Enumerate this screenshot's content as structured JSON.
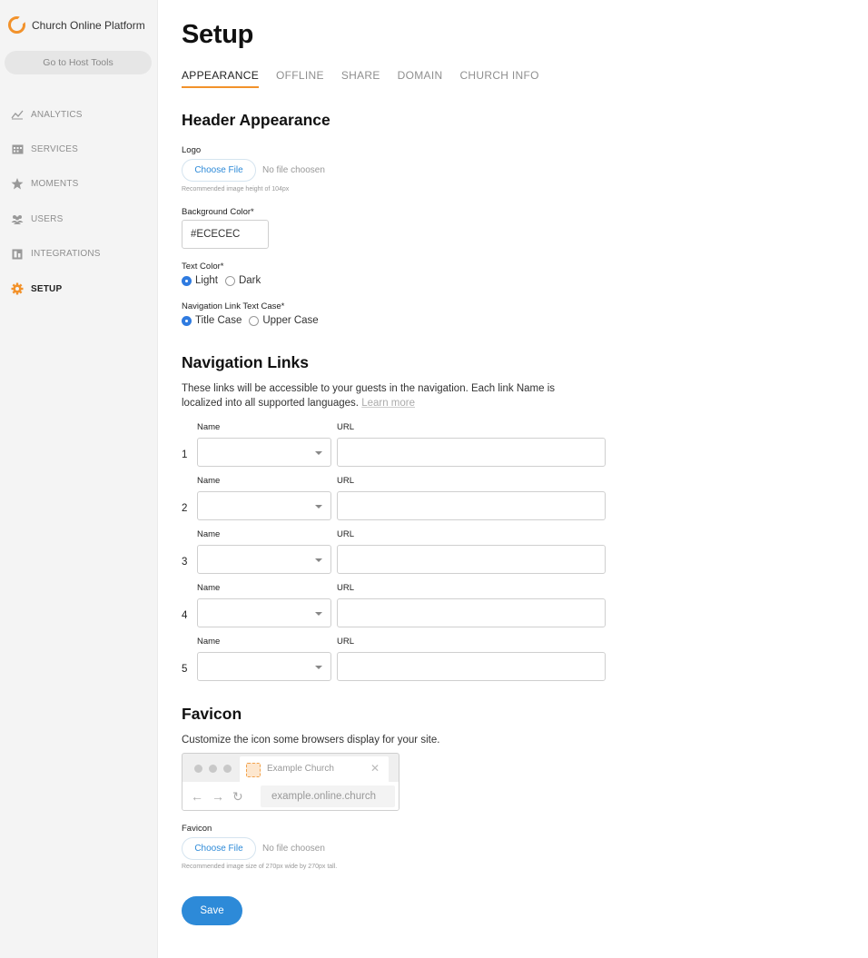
{
  "sidebar": {
    "brand": "Church Online Platform",
    "host_tools": "Go to Host Tools",
    "items": [
      {
        "label": "ANALYTICS",
        "icon": "chart-icon"
      },
      {
        "label": "SERVICES",
        "icon": "calendar-icon"
      },
      {
        "label": "MOMENTS",
        "icon": "star-icon"
      },
      {
        "label": "USERS",
        "icon": "users-icon"
      },
      {
        "label": "INTEGRATIONS",
        "icon": "integrations-icon"
      },
      {
        "label": "SETUP",
        "icon": "gear-icon"
      }
    ],
    "active": "SETUP"
  },
  "page": {
    "title": "Setup",
    "tabs": [
      "APPEARANCE",
      "OFFLINE",
      "SHARE",
      "DOMAIN",
      "CHURCH INFO"
    ],
    "active_tab": "APPEARANCE"
  },
  "header_appearance": {
    "title": "Header Appearance",
    "logo_label": "Logo",
    "choose_file": "Choose File",
    "no_file": "No file choosen",
    "logo_hint": "Recommended image height of 104px",
    "bg_color_label": "Background Color*",
    "bg_color_value": "#ECECEC",
    "text_color_label": "Text Color*",
    "text_color_options": [
      "Light",
      "Dark"
    ],
    "text_color_selected": "Light",
    "nav_case_label": "Navigation Link Text Case*",
    "nav_case_options": [
      "Title Case",
      "Upper Case"
    ],
    "nav_case_selected": "Title Case"
  },
  "navigation_links": {
    "title": "Navigation Links",
    "description": "These links will be accessible to your guests in the navigation. Each link Name is localized into all supported languages.",
    "learn_more": "Learn more",
    "name_label": "Name",
    "url_label": "URL",
    "rows": [
      "1",
      "2",
      "3",
      "4",
      "5"
    ]
  },
  "favicon": {
    "title": "Favicon",
    "description": "Customize the icon some browsers display for your site.",
    "preview_tab_title": "Example Church",
    "preview_address": "example.online.church",
    "label": "Favicon",
    "choose_file": "Choose File",
    "no_file": "No file choosen",
    "hint": "Recommended image size of 270px wide by 270px tall."
  },
  "save_label": "Save",
  "colors": {
    "accent": "#f2922b",
    "primary": "#2d8ad8",
    "radio": "#2f7be0"
  }
}
